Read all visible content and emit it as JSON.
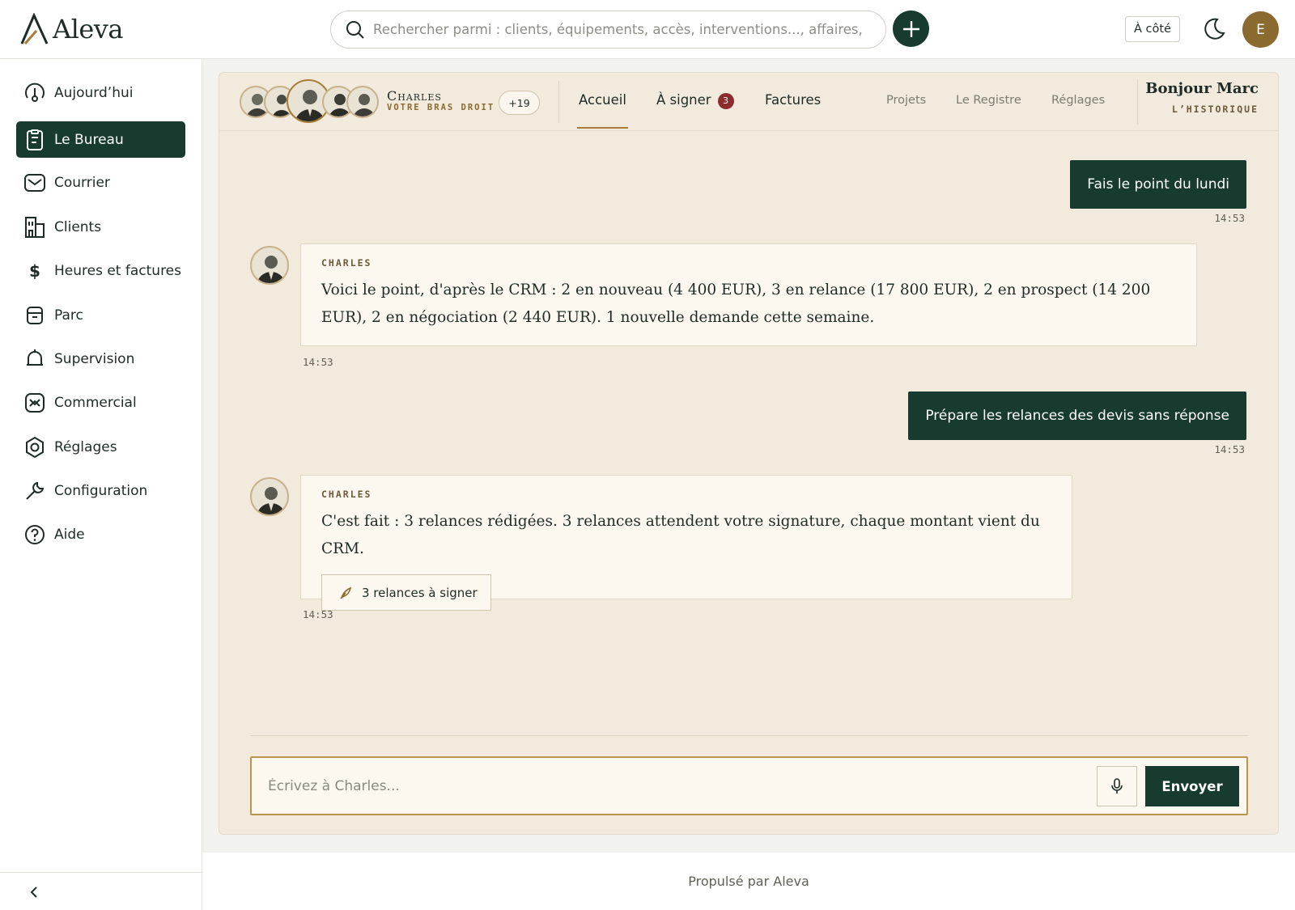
{
  "app": {
    "logo_text": "Aleva"
  },
  "header": {
    "search_placeholder": "Rechercher parmi : clients, équipements, accès, interventions..., affaires,",
    "cote_label": "À côté",
    "user_initial": "E"
  },
  "sidebar": {
    "items": [
      {
        "label": "Aujourd’hui",
        "icon": "clock-home-icon"
      },
      {
        "label": "Le Bureau",
        "icon": "clipboard-icon",
        "active": true
      },
      {
        "label": "Courrier",
        "icon": "mail-icon"
      },
      {
        "label": "Clients",
        "icon": "building-icon"
      },
      {
        "label": "Heures et factures",
        "icon": "dollar-icon"
      },
      {
        "label": "Parc",
        "icon": "archive-icon"
      },
      {
        "label": "Supervision",
        "icon": "bell-icon"
      },
      {
        "label": "Commercial",
        "icon": "handshake-icon"
      },
      {
        "label": "Réglages",
        "icon": "gear-icon"
      },
      {
        "label": "Configuration",
        "icon": "wrench-icon"
      },
      {
        "label": "Aide",
        "icon": "help-icon"
      }
    ]
  },
  "assistant": {
    "name": "Charles",
    "subtitle": "VOTRE BRAS DROIT",
    "more_count": "+19"
  },
  "tabs": {
    "accueil": "Accueil",
    "a_signer": "À signer",
    "a_signer_badge": "3",
    "factures": "Factures",
    "projets": "Projets",
    "registre": "Le Registre",
    "reglages": "Réglages"
  },
  "greeting": {
    "hello": "Bonjour Marc",
    "history": "L’HISTORIQUE"
  },
  "messages": [
    {
      "from": "user",
      "text": "Fais le point du lundi",
      "time": "14:53"
    },
    {
      "from": "bot",
      "name": "CHARLES",
      "text": "Voici le point, d'après le CRM : 2 en nouveau (4 400 EUR), 3 en relance (17 800 EUR), 2 en prospect (14 200 EUR), 2 en négociation (2 440 EUR). 1 nouvelle demande cette semaine.",
      "time": "14:53"
    },
    {
      "from": "user",
      "text": "Prépare les relances des devis sans réponse",
      "time": "14:53"
    },
    {
      "from": "bot",
      "name": "CHARLES",
      "text": "C'est fait : 3 relances rédigées. 3 relances attendent votre signature, chaque montant vient du CRM.",
      "time": "14:53",
      "action_label": "3 relances à signer"
    }
  ],
  "composer": {
    "placeholder": "Écrivez à Charles...",
    "send_label": "Envoyer"
  },
  "footer": {
    "text": "Propulsé par Aleva"
  },
  "colors": {
    "primary": "#173b2f",
    "accent": "#a77c36",
    "panel_bg": "#f2eadd",
    "badge": "#8b2d2d"
  }
}
